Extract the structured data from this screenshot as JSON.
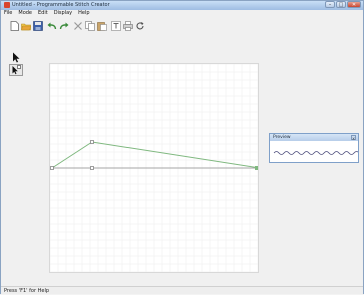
{
  "window": {
    "title": "Untitled - Programmable Stitch Creator",
    "minimize_glyph": "–",
    "maximize_glyph": "□",
    "close_glyph": "✕"
  },
  "menu": {
    "items": [
      {
        "label": "File"
      },
      {
        "label": "Mode"
      },
      {
        "label": "Edit"
      },
      {
        "label": "Display"
      },
      {
        "label": "Help"
      }
    ]
  },
  "toolbar": {
    "icons": [
      "new-file-icon",
      "open-folder-icon",
      "save-icon",
      "undo-icon",
      "redo-icon",
      "delete-icon",
      "copy-icon",
      "paste-icon",
      "text-icon",
      "print-icon",
      "refresh-icon"
    ]
  },
  "tools": {
    "icons": [
      "pointer-arrow-icon",
      "node-edit-icon"
    ]
  },
  "preview": {
    "title": "Preview",
    "close_glyph": "x"
  },
  "status": {
    "text": "Press 'F1' for Help"
  },
  "colors": {
    "stitch_line": "#7fb87f",
    "node": "#777777",
    "grid": "#ececec",
    "preview_wave": "#4a4a7a"
  }
}
